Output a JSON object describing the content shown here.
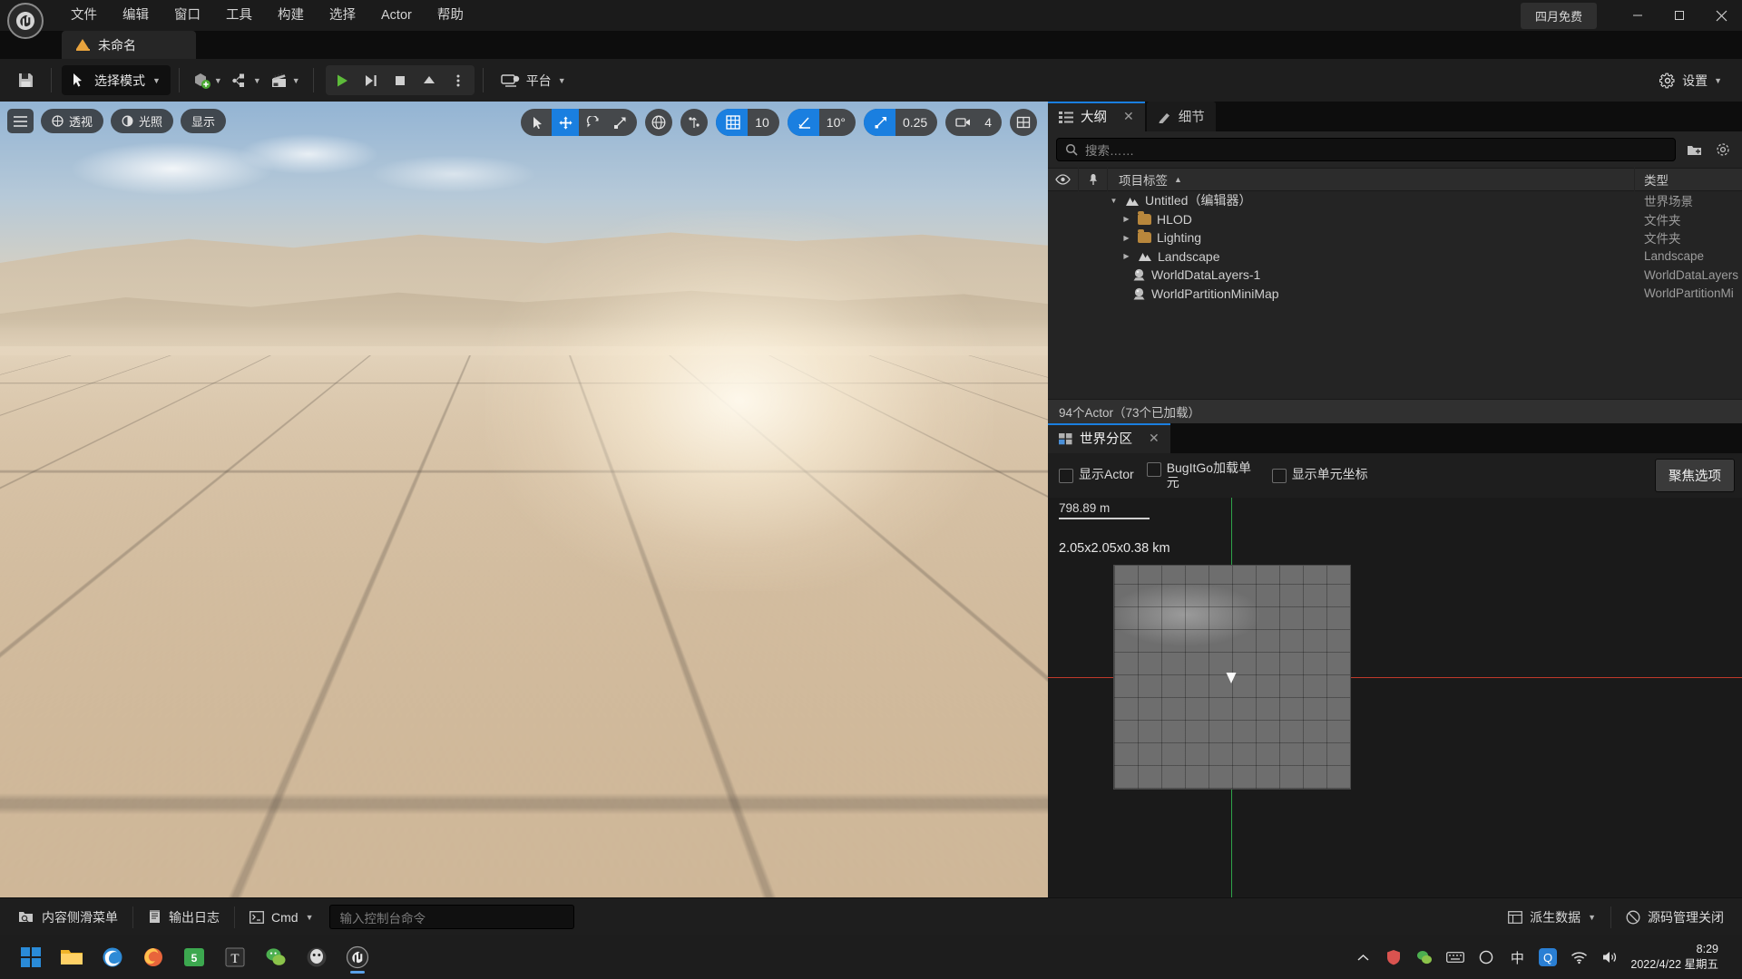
{
  "titlebar": {
    "logo": "unreal-logo",
    "menus": [
      "文件",
      "编辑",
      "窗口",
      "工具",
      "构建",
      "选择",
      "Actor",
      "帮助"
    ],
    "promo": "四月免费",
    "window_buttons": {
      "minimize": "—",
      "maximize": "▢",
      "close": "✕"
    }
  },
  "project_tab": {
    "label": "未命名"
  },
  "toolbar": {
    "save_tooltip": "保存",
    "mode_label": "选择模式",
    "platform_label": "平台",
    "settings_label": "设置"
  },
  "viewport": {
    "overlay_left": {
      "menu": "viewport-menu",
      "perspective": "透视",
      "lighting": "光照",
      "show": "显示"
    },
    "overlay_right": {
      "grid_snap_value": "10",
      "angle_snap_value": "10°",
      "scale_snap_value": "0.25",
      "camera_speed_value": "4"
    }
  },
  "outliner": {
    "tab_label": "大纲",
    "tab_close": "✕",
    "details_tab_label": "细节",
    "search_placeholder": "搜索……",
    "columns": {
      "name": "项目标签",
      "type": "类型"
    },
    "rows": [
      {
        "indent": 0,
        "arrow": "▼",
        "icon": "world-icon",
        "name": "Untitled（编辑器）",
        "type": "世界场景"
      },
      {
        "indent": 1,
        "arrow": "▶",
        "icon": "folder-icon",
        "name": "HLOD",
        "type": "文件夹"
      },
      {
        "indent": 1,
        "arrow": "▶",
        "icon": "folder-icon",
        "name": "Lighting",
        "type": "文件夹"
      },
      {
        "indent": 1,
        "arrow": "▶",
        "icon": "landscape-icon",
        "name": "Landscape",
        "type": "Landscape"
      },
      {
        "indent": 1,
        "arrow": "",
        "icon": "actor-icon",
        "name": "WorldDataLayers-1",
        "type": "WorldDataLayers"
      },
      {
        "indent": 1,
        "arrow": "",
        "icon": "actor-icon",
        "name": "WorldPartitionMiniMap",
        "type": "WorldPartitionMi"
      }
    ],
    "status": "94个Actor（73个已加载）"
  },
  "world_partition": {
    "tab_label": "世界分区",
    "tab_close": "✕",
    "checkboxes": [
      {
        "label": "显示Actor",
        "checked": false
      },
      {
        "label": "BugItGo加载单元",
        "checked": false
      },
      {
        "label": "显示单元坐标",
        "checked": false
      }
    ],
    "focus_button": "聚焦选项",
    "scale_label": "798.89 m",
    "dimensions": "2.05x2.05x0.38 km"
  },
  "statusbar": {
    "content_drawer": "内容侧滑菜单",
    "output_log": "输出日志",
    "cmd_label": "Cmd",
    "cmd_placeholder": "输入控制台命令",
    "derived_data": "派生数据",
    "source_control": "源码管理关闭"
  },
  "taskbar": {
    "apps": [
      "windows-start-icon",
      "file-explorer-icon",
      "edge-icon",
      "firefox-icon",
      "recorder-icon",
      "text-icon",
      "wechat-icon",
      "qq-icon",
      "unreal-icon"
    ],
    "tray": [
      "chevron-up-icon",
      "antivirus-icon",
      "wechat-tray-icon",
      "keyboard-icon",
      "circle-icon",
      "ime-icon",
      "q-icon",
      "wifi-icon",
      "volume-icon"
    ],
    "clock_time": "8:29",
    "clock_date": "2022/4/22 星期五"
  },
  "colors": {
    "accent_blue": "#1a7fe0",
    "panel_bg": "#242424",
    "toolbar_bg": "#1e1e1e",
    "folder_orange": "#b8873c",
    "tab_orange": "#e8a33d"
  }
}
